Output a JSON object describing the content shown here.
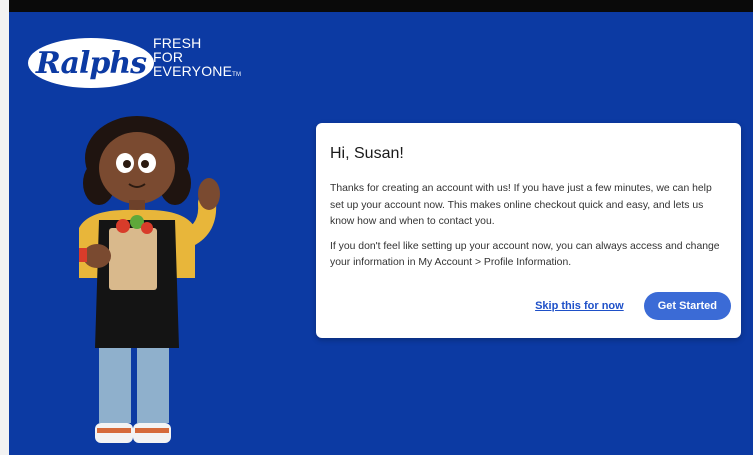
{
  "brand": {
    "logo_text": "Ralphs",
    "tagline_lines": [
      "FRESH",
      "FOR",
      "EVERYONE"
    ],
    "tagline_mark": "TM"
  },
  "card": {
    "greeting": "Hi, Susan!",
    "paragraph1": "Thanks for creating an account with us! If you have just a few minutes, we can help set up your account now. This makes online checkout quick and easy, and lets us know how and when to contact you.",
    "paragraph2": "If you don't feel like setting up your account now, you can always access and change your information in My Account > Profile Information.",
    "skip_label": "Skip this for now",
    "start_label": "Get Started"
  },
  "colors": {
    "background": "#0c3aa3",
    "primary_button": "#3b6bd6",
    "link": "#1e50c8"
  }
}
